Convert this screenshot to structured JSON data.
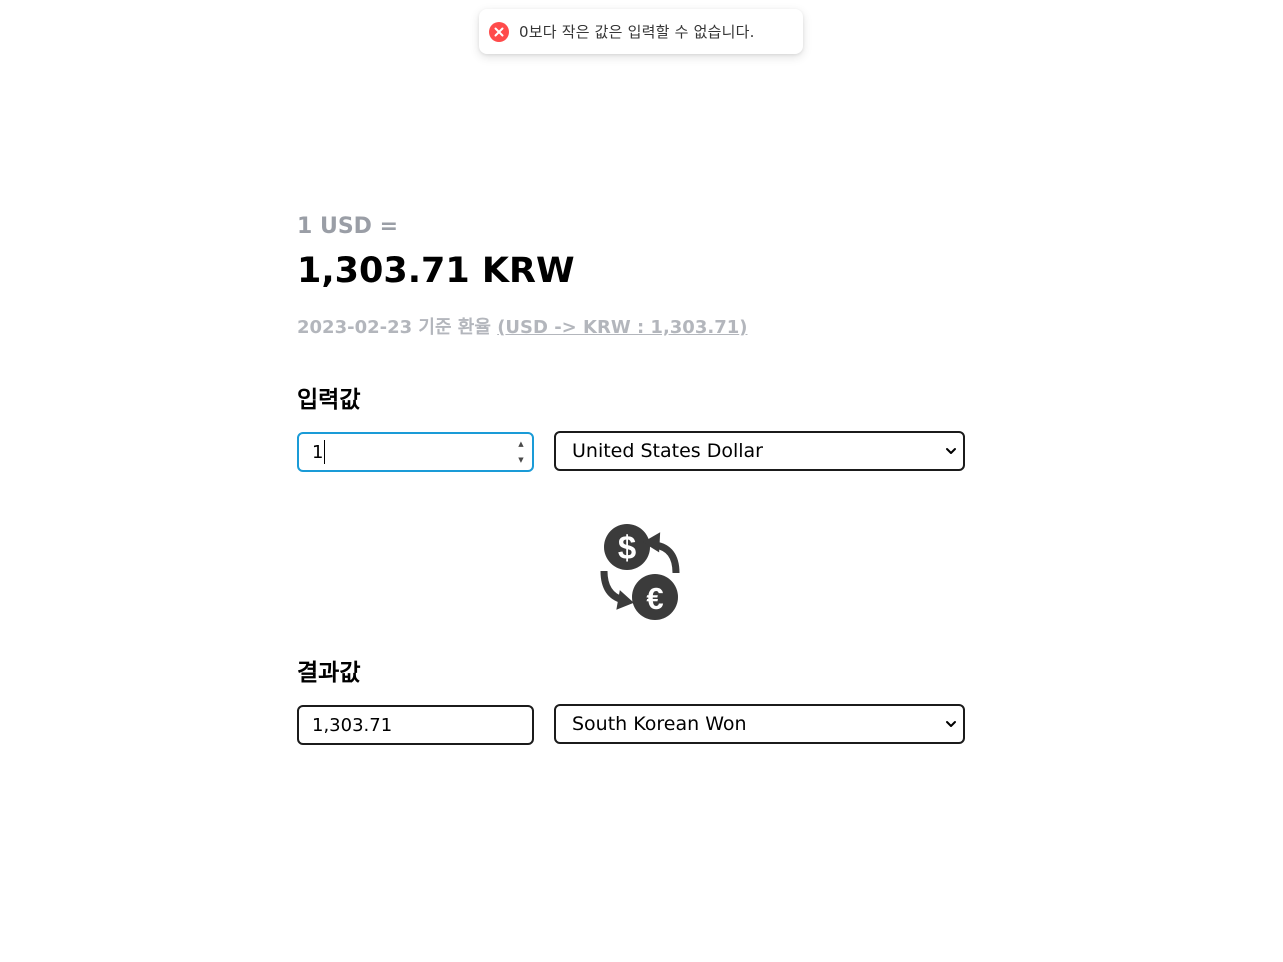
{
  "toast": {
    "icon": "error-circle-icon",
    "message": "0보다 작은 값은 입력할 수 없습니다.",
    "color": "#ff4b4b"
  },
  "rate": {
    "from_label": "1 USD =",
    "to_label": "1,303.71 KRW",
    "date_prefix": "2023-02-23 기준 환율 ",
    "date_link_open": "(",
    "date_link": "USD -> KRW : 1,303.71",
    "date_link_close": ")"
  },
  "input_section": {
    "label": "입력값",
    "amount": "1",
    "currency": "United States Dollar"
  },
  "swap": {
    "icon": "currency-exchange-icon"
  },
  "result_section": {
    "label": "결과값",
    "amount": "1,303.71",
    "currency": "South Korean Won"
  },
  "colors": {
    "focus_border": "#1a9bd7",
    "muted_text": "#9a9ea6"
  }
}
